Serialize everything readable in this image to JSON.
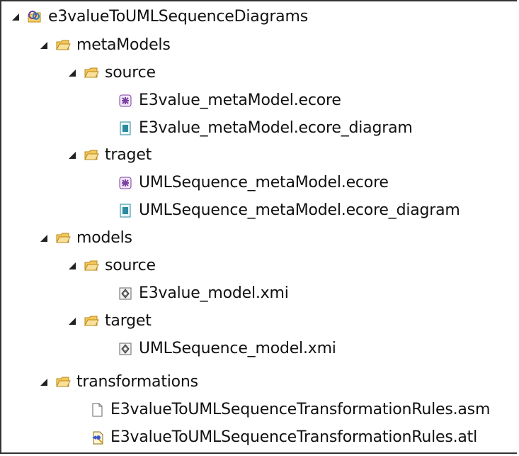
{
  "tree": {
    "project": {
      "label": "e3valueToUMLSequenceDiagrams",
      "icon": "project-folder-icon"
    },
    "metaModels": {
      "label": "metaModels",
      "source": {
        "label": "source",
        "files": [
          {
            "label": "E3value_metaModel.ecore",
            "icon": "ecore-icon"
          },
          {
            "label": "E3value_metaModel.ecore_diagram",
            "icon": "ecore-diagram-icon"
          }
        ]
      },
      "traget": {
        "label": "traget",
        "files": [
          {
            "label": "UMLSequence_metaModel.ecore",
            "icon": "ecore-icon"
          },
          {
            "label": "UMLSequence_metaModel.ecore_diagram",
            "icon": "ecore-diagram-icon"
          }
        ]
      }
    },
    "models": {
      "label": "models",
      "source": {
        "label": "source",
        "files": [
          {
            "label": "E3value_model.xmi",
            "icon": "xmi-icon"
          }
        ]
      },
      "target": {
        "label": "target",
        "files": [
          {
            "label": "UMLSequence_model.xmi",
            "icon": "xmi-icon"
          }
        ]
      }
    },
    "transformations": {
      "label": "transformations",
      "files": [
        {
          "label": "E3valueToUMLSequenceTransformationRules.asm",
          "icon": "file-icon"
        },
        {
          "label": "E3valueToUMLSequenceTransformationRules.atl",
          "icon": "atl-icon"
        }
      ]
    }
  },
  "colors": {
    "folder_fill": "#f6d06a",
    "folder_stroke": "#b98a1a",
    "arrow": "#222222",
    "ecore_purple": "#7b3fa0",
    "diagram_teal": "#2c8aa0"
  }
}
